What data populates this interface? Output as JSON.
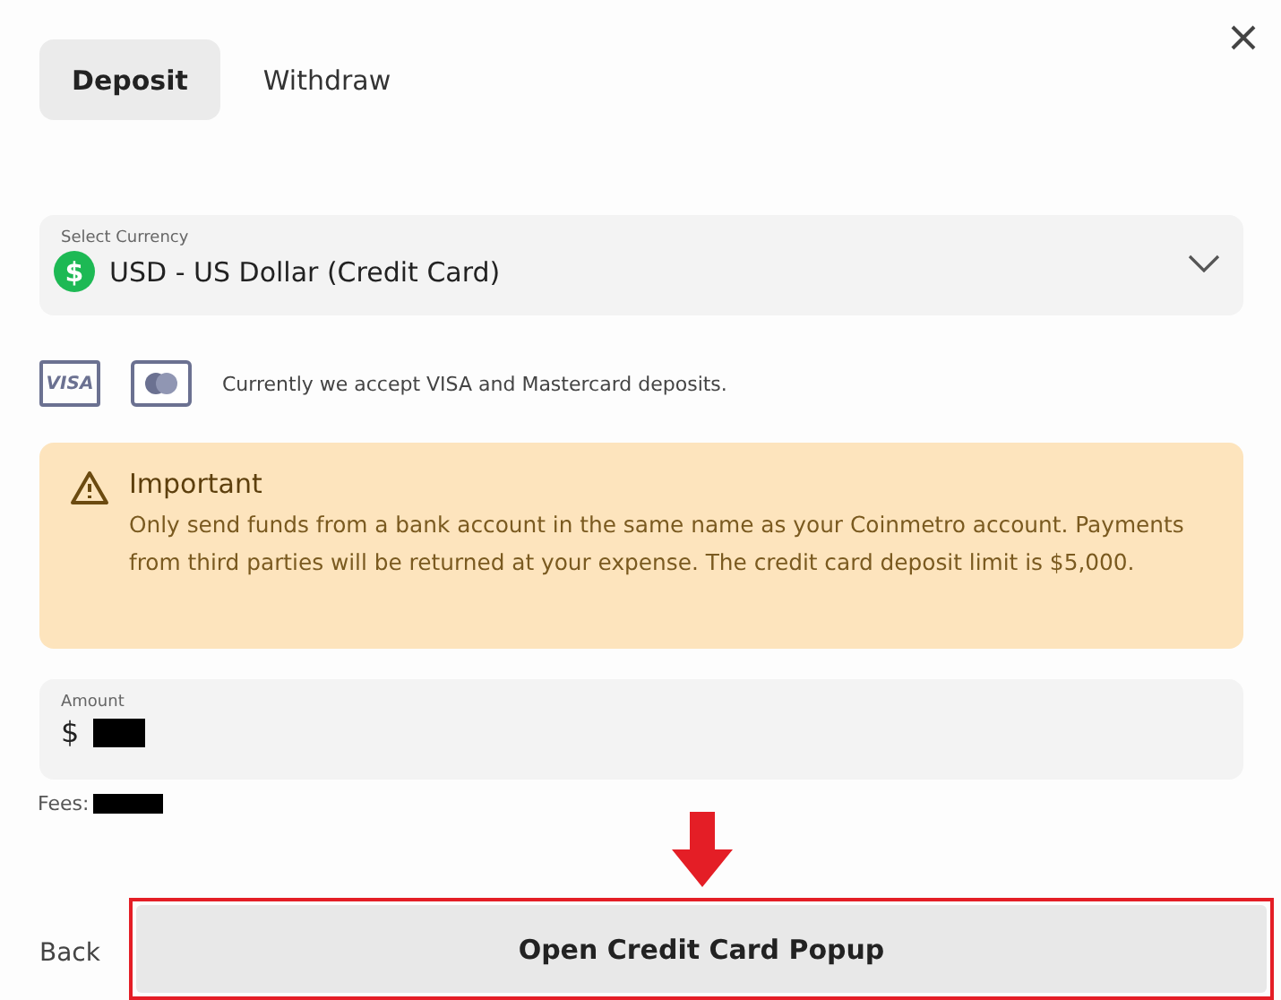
{
  "tabs": [
    {
      "label": "Deposit",
      "selected": true
    },
    {
      "label": "Withdraw",
      "selected": false
    }
  ],
  "currency": {
    "label": "Select Currency",
    "value": "USD - US Dollar (Credit Card)",
    "symbol": "$"
  },
  "cards": {
    "visa_label": "VISA",
    "note": "Currently we accept VISA and Mastercard deposits."
  },
  "notice": {
    "title": "Important",
    "text": "Only send funds from a bank account in the same name as your Coinmetro account. Payments from third parties will be returned at your expense. The credit card deposit limit is $5,000."
  },
  "amount": {
    "label": "Amount",
    "currency": "$"
  },
  "fees": {
    "label": "Fees:"
  },
  "footer": {
    "back": "Back",
    "primary": "Open Credit Card Popup",
    "highlighted": true
  }
}
